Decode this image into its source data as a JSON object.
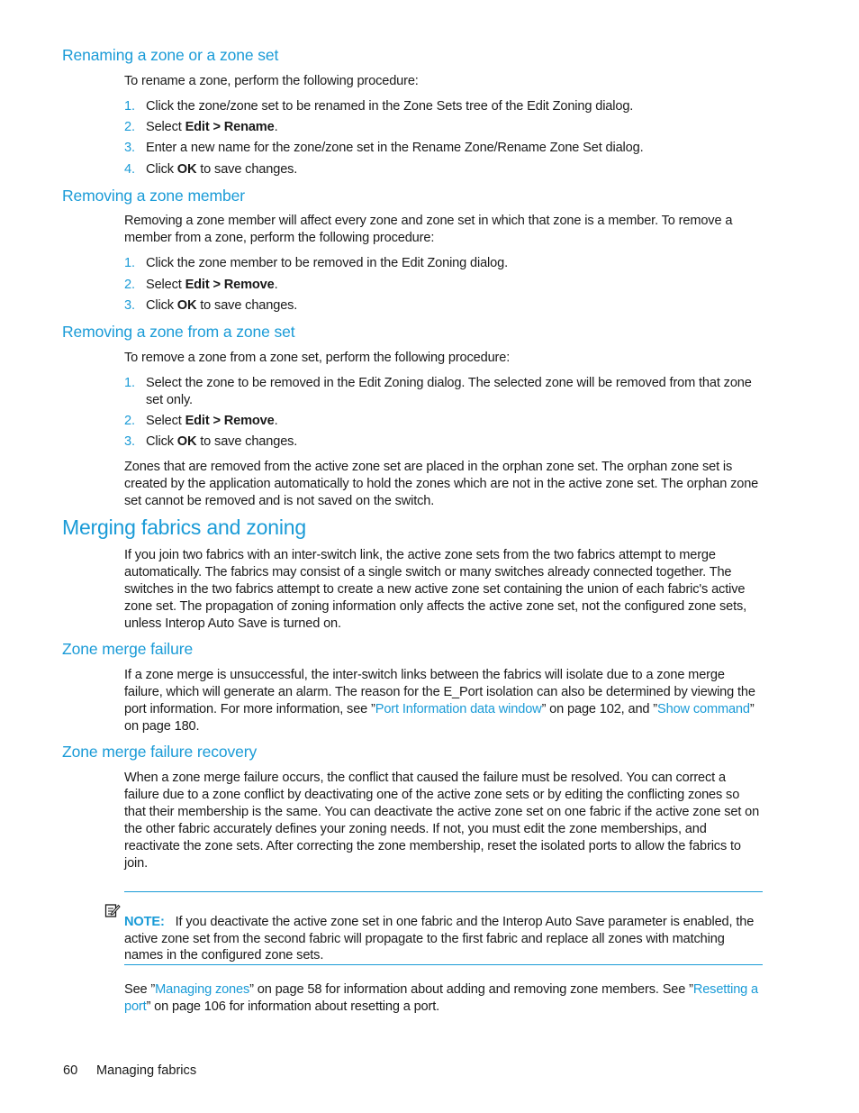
{
  "sections": {
    "renaming": {
      "title": "Renaming a zone or a zone set",
      "intro": "To rename a zone, perform the following procedure:",
      "steps": [
        {
          "num": "1.",
          "pre": "Click the zone/zone set to be renamed in the Zone Sets tree of the Edit Zoning dialog.",
          "bold": "",
          "post": ""
        },
        {
          "num": "2.",
          "pre": "Select ",
          "bold": "Edit > Rename",
          "post": "."
        },
        {
          "num": "3.",
          "pre": "Enter a new name for the zone/zone set in the Rename Zone/Rename Zone Set dialog.",
          "bold": "",
          "post": ""
        },
        {
          "num": "4.",
          "pre": "Click ",
          "bold": "OK",
          "post": " to save changes."
        }
      ]
    },
    "removing_member": {
      "title": "Removing a zone member",
      "intro": "Removing a zone member will affect every zone and zone set in which that zone is a member. To remove a member from a zone, perform the following procedure:",
      "steps": [
        {
          "num": "1.",
          "pre": "Click the zone member to be removed in the Edit Zoning dialog.",
          "bold": "",
          "post": ""
        },
        {
          "num": "2.",
          "pre": "Select ",
          "bold": "Edit > Remove",
          "post": "."
        },
        {
          "num": "3.",
          "pre": "Click ",
          "bold": "OK",
          "post": " to save changes."
        }
      ]
    },
    "removing_zone": {
      "title": "Removing a zone from a zone set",
      "intro": "To remove a zone from a zone set, perform the following procedure:",
      "steps": [
        {
          "num": "1.",
          "pre": "Select the zone to be removed in the Edit Zoning dialog. The selected zone will be removed from that zone set only.",
          "bold": "",
          "post": ""
        },
        {
          "num": "2.",
          "pre": "Select ",
          "bold": "Edit > Remove",
          "post": "."
        },
        {
          "num": "3.",
          "pre": "Click ",
          "bold": "OK",
          "post": " to save changes."
        }
      ],
      "outro": "Zones that are removed from the active zone set are placed in the orphan zone set. The orphan zone set is created by the application automatically to hold the zones which are not in the active zone set. The orphan zone set cannot be removed and is not saved on the switch."
    },
    "merging": {
      "title": "Merging fabrics and zoning",
      "body": "If you join two fabrics with an inter-switch link, the active zone sets from the two fabrics attempt to merge automatically. The fabrics may consist of a single switch or many switches already connected together. The switches in the two fabrics attempt to create a new active zone set containing the union of each fabric's active zone set. The propagation of zoning information only affects the active zone set, not the configured zone sets, unless Interop Auto Save is turned on."
    },
    "merge_failure": {
      "title": "Zone merge failure",
      "body_pre": "If a zone merge is unsuccessful, the inter-switch links between the fabrics will isolate due to a zone merge failure, which will generate an alarm. The reason for the E_Port isolation can also be determined by viewing the port information. For more information, see ”",
      "link1": "Port Information data window",
      "mid": "” on page 102, and ”",
      "link2": "Show command",
      "post": "” on page 180."
    },
    "merge_recovery": {
      "title": "Zone merge failure recovery",
      "body": "When a zone merge failure occurs, the conflict that caused the failure must be resolved. You can correct a failure due to a zone conflict by deactivating one of the active zone sets or by editing the conflicting zones so that their membership is the same. You can deactivate the active zone set on one fabric if the active zone set on the other fabric accurately defines your zoning needs. If not, you must edit the zone memberships, and reactivate the zone sets. After correcting the zone membership, reset the isolated ports to allow the fabrics to join.",
      "note_label": "NOTE:",
      "note_text": "If you deactivate the active zone set in one fabric and the Interop Auto Save parameter is enabled, the active zone set from the second fabric will propagate to the first fabric and replace all zones with matching names in the configured zone sets.",
      "see_pre": "See ”",
      "see_link1": "Managing zones",
      "see_mid": "” on page 58 for information about adding and removing zone members. See ”",
      "see_link2": "Resetting a port",
      "see_post": "” on page 106 for information about resetting a port."
    }
  },
  "footer": {
    "page_number": "60",
    "chapter": "Managing fabrics"
  },
  "colors": {
    "accent": "#1a9bd7",
    "text": "#1a1a1a"
  }
}
